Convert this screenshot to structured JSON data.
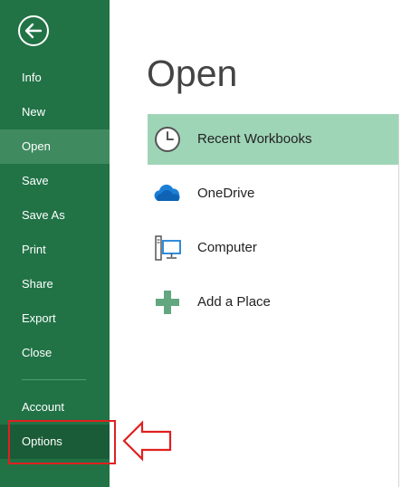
{
  "sidebar": {
    "back_icon": "back-arrow-icon",
    "items": [
      {
        "label": "Info"
      },
      {
        "label": "New"
      },
      {
        "label": "Open"
      },
      {
        "label": "Save"
      },
      {
        "label": "Save As"
      },
      {
        "label": "Print"
      },
      {
        "label": "Share"
      },
      {
        "label": "Export"
      },
      {
        "label": "Close"
      },
      {
        "label": "Account"
      },
      {
        "label": "Options"
      }
    ],
    "active_item": "Open",
    "highlighted_item": "Options"
  },
  "main": {
    "title": "Open",
    "places": [
      {
        "label": "Recent Workbooks",
        "icon": "clock-icon"
      },
      {
        "label": "OneDrive",
        "icon": "onedrive-cloud-icon"
      },
      {
        "label": "Computer",
        "icon": "computer-icon"
      },
      {
        "label": "Add a Place",
        "icon": "add-plus-icon"
      }
    ],
    "selected_place": "Recent Workbooks"
  },
  "annotation": {
    "highlight_color": "#e02020",
    "pointer_icon": "left-arrow-annotation-icon"
  },
  "colors": {
    "sidebar": "#217346",
    "sidebar_active": "#3f8b5f",
    "sidebar_highlight": "#1a5c37",
    "place_selected": "#9fd5b7"
  }
}
